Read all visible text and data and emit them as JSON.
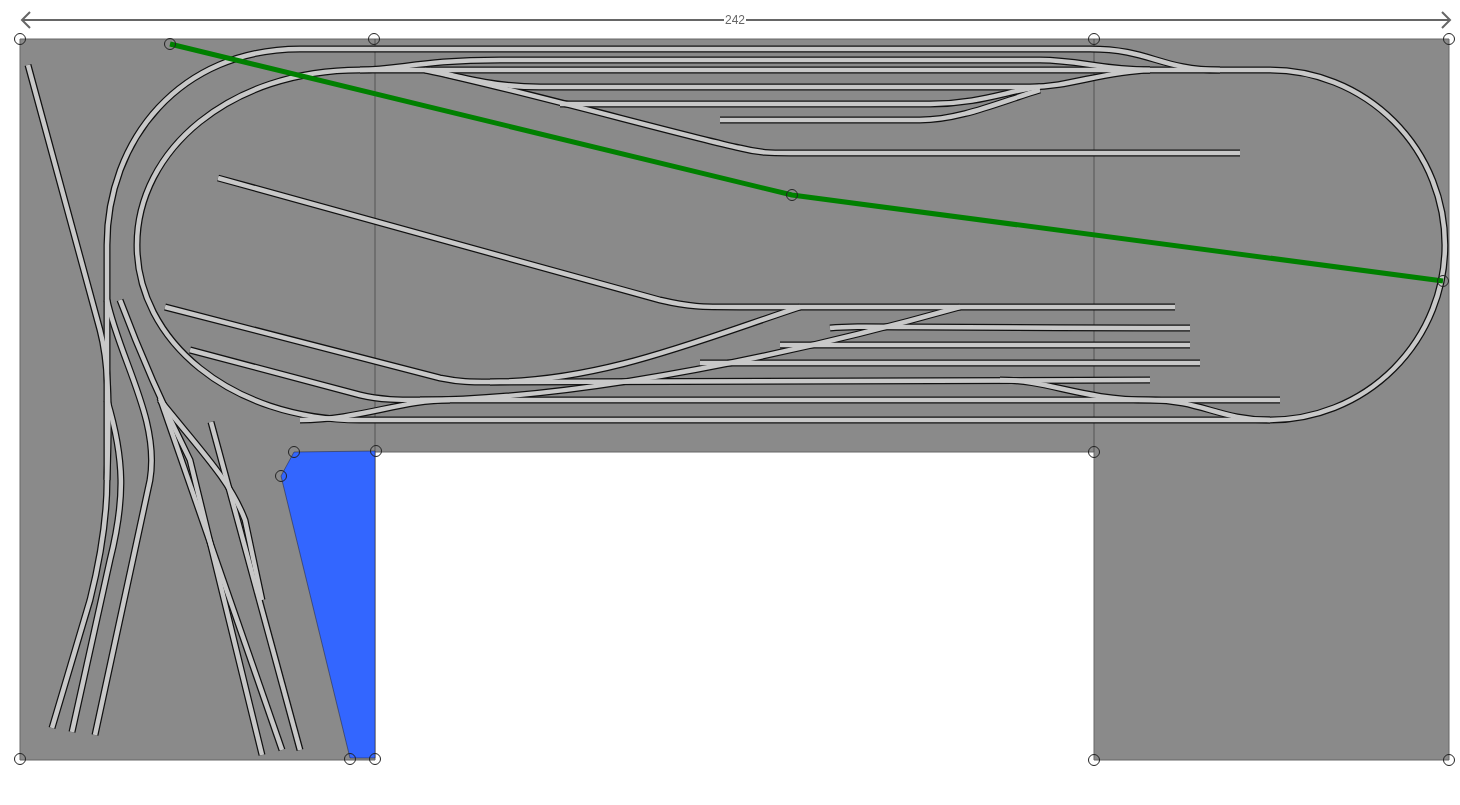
{
  "dimension": {
    "label": "242"
  }
}
